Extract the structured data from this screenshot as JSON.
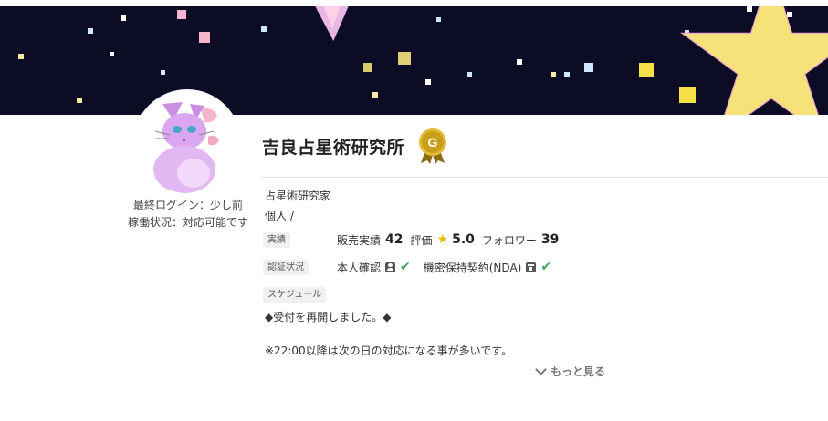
{
  "banner": {
    "colors": {
      "sky": "#0c0c24",
      "star": "#f7e27a",
      "star_outline": "#f3a6d0"
    }
  },
  "profile": {
    "avatar_icon": "cat-avatar-icon",
    "last_login": "最終ログイン：少し前",
    "availability": "稼働状況：対応可能です"
  },
  "seller": {
    "name": "吉良占星術研究所",
    "rank_badge_letter": "G",
    "rank_badge_color": "#c9a21a",
    "occupation": "占星術研究家",
    "entity_type": "個人 /"
  },
  "achievements": {
    "tag": "実績",
    "sales_label": "販売実績",
    "sales_value": "42",
    "rating_label": "評価",
    "rating_value": "5.0",
    "followers_label": "フォロワー",
    "followers_value": "39"
  },
  "verification": {
    "tag": "認証状況",
    "identity_label": "本人確認",
    "nda_label": "機密保持契約(NDA)",
    "check_color": "#3aa85a"
  },
  "schedule": {
    "tag": "スケジュール",
    "line1": "◆受付を再開しました。◆",
    "line2": "※22:00以降は次の日の対応になる事が多いです。",
    "more_label": "もっと見る"
  }
}
